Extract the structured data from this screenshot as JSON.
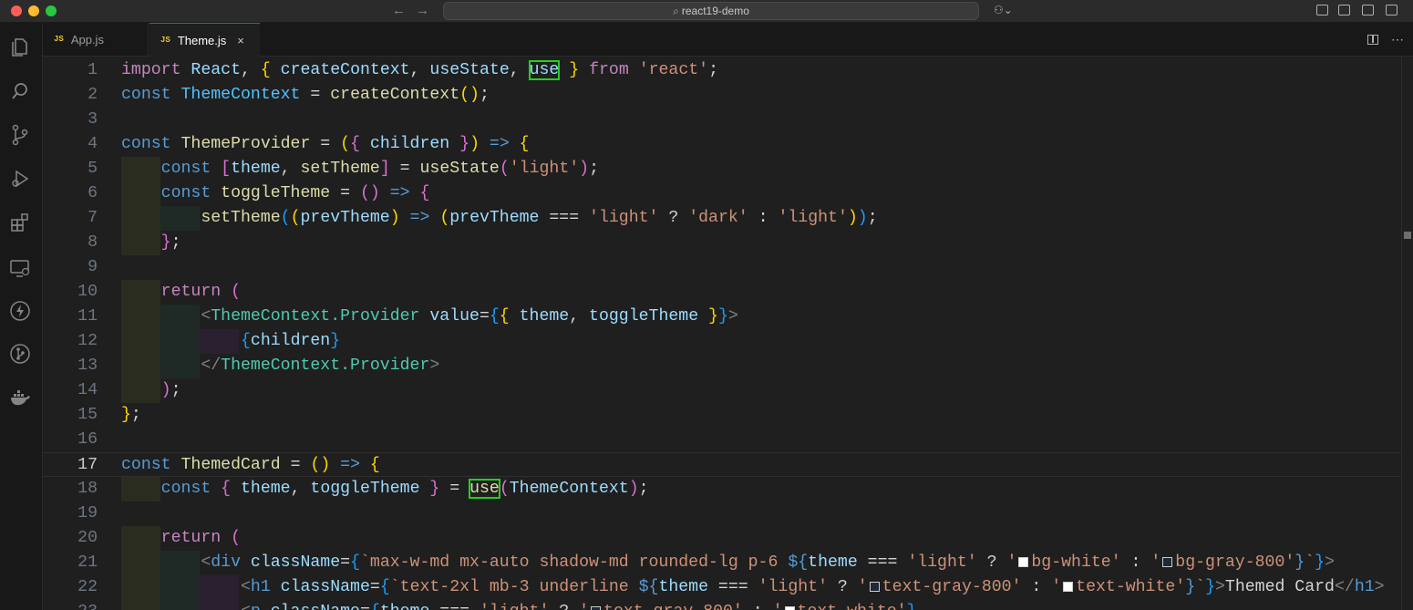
{
  "window": {
    "title": "react19-demo"
  },
  "tabs": [
    {
      "label": "App.js",
      "badge": "JS"
    },
    {
      "label": "Theme.js",
      "badge": "JS",
      "close": "×"
    }
  ],
  "icons": {
    "back": "←",
    "forward": "→",
    "search": "⌕",
    "copilot": "⚇⌄",
    "explorer": "files-icon",
    "search_view": "search-icon",
    "scm": "source-control-icon",
    "debug": "run-debug-icon",
    "extensions": "extensions-icon",
    "remote": "remote-explorer-icon",
    "lightning": "lightning-icon",
    "git": "git-graph-icon",
    "docker": "docker-icon"
  },
  "colors": {
    "highlight_box": "#22d11d",
    "active_tab_border": "#0078d4"
  },
  "editor": {
    "current_line": 17,
    "line_numbers": [
      "1",
      "2",
      "3",
      "4",
      "5",
      "6",
      "7",
      "8",
      "9",
      "10",
      "11",
      "12",
      "13",
      "14",
      "15",
      "16",
      "17",
      "18",
      "19",
      "20",
      "21",
      "22",
      "23"
    ],
    "lines": [
      [
        [
          "import",
          "kwc"
        ],
        [
          " React",
          "vr"
        ],
        [
          ", ",
          "op"
        ],
        [
          "{",
          "b1"
        ],
        [
          " createContext",
          "vr"
        ],
        [
          ", ",
          "op"
        ],
        [
          "useState",
          "vr"
        ],
        [
          ", ",
          "op"
        ],
        [
          "use",
          "vr hl"
        ],
        [
          " ",
          "op"
        ],
        [
          "}",
          "b1"
        ],
        [
          " from ",
          "kwc"
        ],
        [
          "'react'",
          "st"
        ],
        [
          ";",
          "op"
        ]
      ],
      [
        [
          "const ",
          "kw"
        ],
        [
          "ThemeContext",
          "cs"
        ],
        [
          " = ",
          "op"
        ],
        [
          "createContext",
          "fn"
        ],
        [
          "(",
          "b1"
        ],
        [
          ")",
          "b1"
        ],
        [
          ";",
          "op"
        ]
      ],
      [],
      [
        [
          "const ",
          "kw"
        ],
        [
          "ThemeProvider",
          "fn"
        ],
        [
          " = ",
          "op"
        ],
        [
          "(",
          "b1"
        ],
        [
          "{",
          "b2"
        ],
        [
          " children ",
          "vr"
        ],
        [
          "}",
          "b2"
        ],
        [
          ")",
          "b1"
        ],
        [
          " => ",
          "kw"
        ],
        [
          "{",
          "b1"
        ]
      ],
      [
        [
          "    const ",
          "kw"
        ],
        [
          "[",
          "b2"
        ],
        [
          "theme",
          "vr"
        ],
        [
          ", ",
          "op"
        ],
        [
          "setTheme",
          "fn"
        ],
        [
          "]",
          "b2"
        ],
        [
          " = ",
          "op"
        ],
        [
          "useState",
          "fn"
        ],
        [
          "(",
          "b2"
        ],
        [
          "'light'",
          "st"
        ],
        [
          ")",
          "b2"
        ],
        [
          ";",
          "op"
        ]
      ],
      [
        [
          "    const ",
          "kw"
        ],
        [
          "toggleTheme",
          "fn"
        ],
        [
          " = ",
          "op"
        ],
        [
          "(",
          "b2"
        ],
        [
          ")",
          "b2"
        ],
        [
          " => ",
          "kw"
        ],
        [
          "{",
          "b2"
        ]
      ],
      [
        [
          "        setTheme",
          "fn"
        ],
        [
          "(",
          "b3"
        ],
        [
          "(",
          "b1"
        ],
        [
          "prevTheme",
          "vr"
        ],
        [
          ")",
          "b1"
        ],
        [
          " => ",
          "kw"
        ],
        [
          "(",
          "b1"
        ],
        [
          "prevTheme",
          "vr"
        ],
        [
          " === ",
          "op"
        ],
        [
          "'light'",
          "st"
        ],
        [
          " ? ",
          "op"
        ],
        [
          "'dark'",
          "st"
        ],
        [
          " : ",
          "op"
        ],
        [
          "'light'",
          "st"
        ],
        [
          ")",
          "b1"
        ],
        [
          ")",
          "b3"
        ],
        [
          ";",
          "op"
        ]
      ],
      [
        [
          "    ",
          "op"
        ],
        [
          "}",
          "b2"
        ],
        [
          ";",
          "op"
        ]
      ],
      [],
      [
        [
          "    return ",
          "kwc"
        ],
        [
          "(",
          "b2"
        ]
      ],
      [
        [
          "        <",
          "pn"
        ],
        [
          "ThemeContext.Provider",
          "tg"
        ],
        [
          " value",
          "at"
        ],
        [
          "=",
          "op"
        ],
        [
          "{",
          "b3"
        ],
        [
          "{",
          "b1"
        ],
        [
          " theme",
          "vr"
        ],
        [
          ", ",
          "op"
        ],
        [
          "toggleTheme ",
          "vr"
        ],
        [
          "}",
          "b1"
        ],
        [
          "}",
          "b3"
        ],
        [
          ">",
          "pn"
        ]
      ],
      [
        [
          "            ",
          "op"
        ],
        [
          "{",
          "b3"
        ],
        [
          "children",
          "vr"
        ],
        [
          "}",
          "b3"
        ]
      ],
      [
        [
          "        </",
          "pn"
        ],
        [
          "ThemeContext.Provider",
          "tg"
        ],
        [
          ">",
          "pn"
        ]
      ],
      [
        [
          "    ",
          "op"
        ],
        [
          ")",
          "b2"
        ],
        [
          ";",
          "op"
        ]
      ],
      [
        [
          "}",
          "b1"
        ],
        [
          ";",
          "op"
        ]
      ],
      [],
      [
        [
          "const ",
          "kw"
        ],
        [
          "ThemedCard",
          "fn"
        ],
        [
          " = ",
          "op"
        ],
        [
          "(",
          "b1"
        ],
        [
          ")",
          "b1"
        ],
        [
          " => ",
          "kw"
        ],
        [
          "{",
          "b1"
        ]
      ],
      [
        [
          "    const ",
          "kw"
        ],
        [
          "{",
          "b2"
        ],
        [
          " theme",
          "vr"
        ],
        [
          ", ",
          "op"
        ],
        [
          "toggleTheme ",
          "vr"
        ],
        [
          "}",
          "b2"
        ],
        [
          " = ",
          "op"
        ],
        [
          "use",
          "fn hl"
        ],
        [
          "(",
          "b2"
        ],
        [
          "ThemeContext",
          "vr"
        ],
        [
          ")",
          "b2"
        ],
        [
          ";",
          "op"
        ]
      ],
      [],
      [
        [
          "    return ",
          "kwc"
        ],
        [
          "(",
          "b2"
        ]
      ],
      [
        [
          "        <",
          "pn"
        ],
        [
          "div",
          "kw"
        ],
        [
          " className",
          "at"
        ],
        [
          "=",
          "op"
        ],
        [
          "{",
          "b3"
        ],
        [
          "`max-w-md mx-auto shadow-md rounded-lg p-6 ",
          "st"
        ],
        [
          "${",
          "kw"
        ],
        [
          "theme",
          "vr"
        ],
        [
          " === ",
          "op"
        ],
        [
          "'light'",
          "st"
        ],
        [
          " ? ",
          "op"
        ],
        [
          "'",
          "st"
        ],
        [
          "#swatch-white",
          "sw"
        ],
        [
          "bg-white'",
          "st"
        ],
        [
          " : ",
          "op"
        ],
        [
          "'",
          "st"
        ],
        [
          "#swatch-gray",
          "sw"
        ],
        [
          "bg-gray-800'",
          "st"
        ],
        [
          "}",
          "kw"
        ],
        [
          "`",
          "st"
        ],
        [
          "}",
          "b3"
        ],
        [
          ">",
          "pn"
        ]
      ],
      [
        [
          "            <",
          "pn"
        ],
        [
          "h1",
          "kw"
        ],
        [
          " className",
          "at"
        ],
        [
          "=",
          "op"
        ],
        [
          "{",
          "b3"
        ],
        [
          "`text-2xl mb-3 underline ",
          "st"
        ],
        [
          "${",
          "kw"
        ],
        [
          "theme",
          "vr"
        ],
        [
          " === ",
          "op"
        ],
        [
          "'light'",
          "st"
        ],
        [
          " ? ",
          "op"
        ],
        [
          "'",
          "st"
        ],
        [
          "#swatch-gray",
          "sw"
        ],
        [
          "text-gray-800'",
          "st"
        ],
        [
          " : ",
          "op"
        ],
        [
          "'",
          "st"
        ],
        [
          "#swatch-white",
          "sw"
        ],
        [
          "text-white'",
          "st"
        ],
        [
          "}",
          "kw"
        ],
        [
          "`",
          "st"
        ],
        [
          "}",
          "b3"
        ],
        [
          ">",
          "pn"
        ],
        [
          "Themed Card",
          "op"
        ],
        [
          "</",
          "pn"
        ],
        [
          "h1",
          "kw"
        ],
        [
          ">",
          "pn"
        ]
      ],
      [
        [
          "            <",
          "pn"
        ],
        [
          "p",
          "kw"
        ],
        [
          " className",
          "at"
        ],
        [
          "=",
          "op"
        ],
        [
          "{",
          "b3"
        ],
        [
          "theme",
          "vr"
        ],
        [
          " === ",
          "op"
        ],
        [
          "'light'",
          "st"
        ],
        [
          " ? ",
          "op"
        ],
        [
          "'",
          "st"
        ],
        [
          "#swatch-gray",
          "sw"
        ],
        [
          "text-gray-800'",
          "st"
        ],
        [
          " : ",
          "op"
        ],
        [
          "'",
          "st"
        ],
        [
          "#swatch-white",
          "sw"
        ],
        [
          "text-white'",
          "st"
        ],
        [
          "}",
          "b3"
        ]
      ]
    ]
  }
}
